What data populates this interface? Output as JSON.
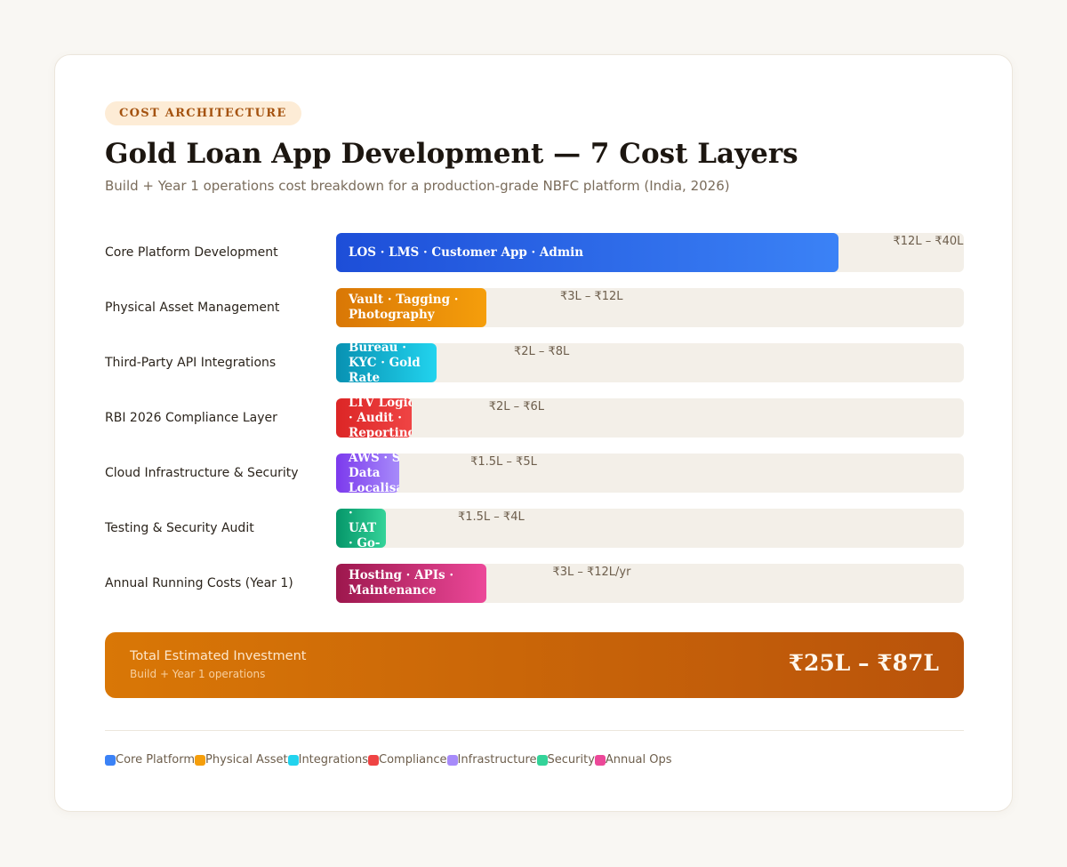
{
  "eyebrow": "COST ARCHITECTURE",
  "title": "Gold Loan App Development — 7 Cost Layers",
  "subtitle": "Build + Year 1 operations cost breakdown for a production-grade NBFC platform (India, 2026)",
  "chart_data": {
    "type": "bar",
    "orientation": "horizontal",
    "unit": "₹ Lakh (upper estimate)",
    "xlim": [
      0,
      50
    ],
    "grid": false,
    "legend_position": "bottom",
    "categories": [
      "Core Platform Development",
      "Physical Asset Management",
      "Third-Party API Integrations",
      "RBI 2026 Compliance Layer",
      "Cloud Infrastructure & Security",
      "Testing & Security Audit",
      "Annual Running Costs (Year 1)"
    ],
    "bars": [
      {
        "label": "Core Platform Development",
        "bar_text": "LOS · LMS · Customer App · Admin",
        "range_text": "₹12L – ₹40L",
        "low": 12,
        "high": 40,
        "legend": "Core Platform",
        "color_from": "#1d4ed8",
        "color_to": "#3b82f6",
        "swatch": "#3b82f6"
      },
      {
        "label": "Physical Asset Management",
        "bar_text": "Vault · Tagging · Photography",
        "range_text": "₹3L – ₹12L",
        "low": 3,
        "high": 12,
        "legend": "Physical Asset",
        "color_from": "#d97706",
        "color_to": "#f59e0b",
        "swatch": "#f59e0b"
      },
      {
        "label": "Third-Party API Integrations",
        "bar_text": "Bureau · KYC · Gold Rate",
        "range_text": "₹2L – ₹8L",
        "low": 2,
        "high": 8,
        "legend": "Integrations",
        "color_from": "#0891b2",
        "color_to": "#22d3ee",
        "swatch": "#22d3ee"
      },
      {
        "label": "RBI 2026 Compliance Layer",
        "bar_text": "LTV Logic · Audit · Reporting",
        "range_text": "₹2L – ₹6L",
        "low": 2,
        "high": 6,
        "legend": "Compliance",
        "color_from": "#dc2626",
        "color_to": "#ef4444",
        "swatch": "#ef4444"
      },
      {
        "label": "Cloud Infrastructure & Security",
        "bar_text": "AWS · SSL · Data Localisation",
        "range_text": "₹1.5L – ₹5L",
        "low": 1.5,
        "high": 5,
        "legend": "Infrastructure",
        "color_from": "#7c3aed",
        "color_to": "#a78bfa",
        "swatch": "#a78bfa"
      },
      {
        "label": "Testing & Security Audit",
        "bar_text": "VAPT · UAT · Go-Live",
        "range_text": "₹1.5L – ₹4L",
        "low": 1.5,
        "high": 4,
        "legend": "Security",
        "color_from": "#059669",
        "color_to": "#34d399",
        "swatch": "#34d399"
      },
      {
        "label": "Annual Running Costs (Year 1)",
        "bar_text": "Hosting · APIs · Maintenance",
        "range_text": "₹3L – ₹12L/yr",
        "low": 3,
        "high": 12,
        "legend": "Annual Ops",
        "color_from": "#9d174d",
        "color_to": "#ec4899",
        "swatch": "#ec4899"
      }
    ]
  },
  "total": {
    "label": "Total Estimated Investment",
    "sublabel": "Build + Year 1 operations",
    "value": "₹25L – ₹87L"
  },
  "colors": {
    "accent": "#d97706",
    "track": "#f3efe8",
    "background": "#f9f7f3"
  }
}
